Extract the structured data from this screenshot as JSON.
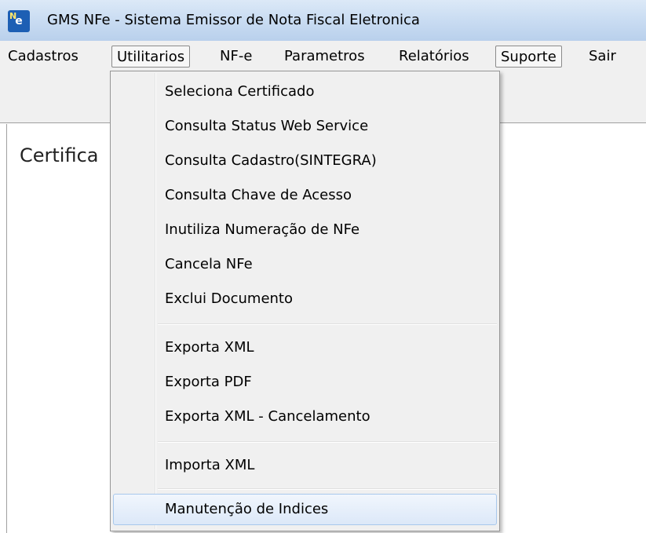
{
  "window": {
    "title": "GMS NFe - Sistema Emissor de Nota Fiscal Eletronica",
    "icon": "nfe-app-icon"
  },
  "menubar": {
    "items": [
      {
        "label": "Cadastros"
      },
      {
        "label": "Utilitarios"
      },
      {
        "label": "NF-e"
      },
      {
        "label": "Parametros"
      },
      {
        "label": "Relatórios"
      },
      {
        "label": "Suporte"
      },
      {
        "label": "Sair"
      }
    ]
  },
  "content": {
    "label": "Certifica"
  },
  "dropdown": {
    "items": [
      {
        "label": "Seleciona Certificado"
      },
      {
        "label": "Consulta Status Web Service"
      },
      {
        "label": "Consulta Cadastro(SINTEGRA)"
      },
      {
        "label": "Consulta Chave de Acesso"
      },
      {
        "label": "Inutiliza Numeração de NFe"
      },
      {
        "label": "Cancela NFe"
      },
      {
        "label": "Exclui Documento"
      },
      {
        "label": "Exporta XML"
      },
      {
        "label": "Exporta PDF"
      },
      {
        "label": "Exporta XML - Cancelamento"
      },
      {
        "label": "Importa XML"
      },
      {
        "label": "Manutenção de Indices"
      }
    ]
  }
}
